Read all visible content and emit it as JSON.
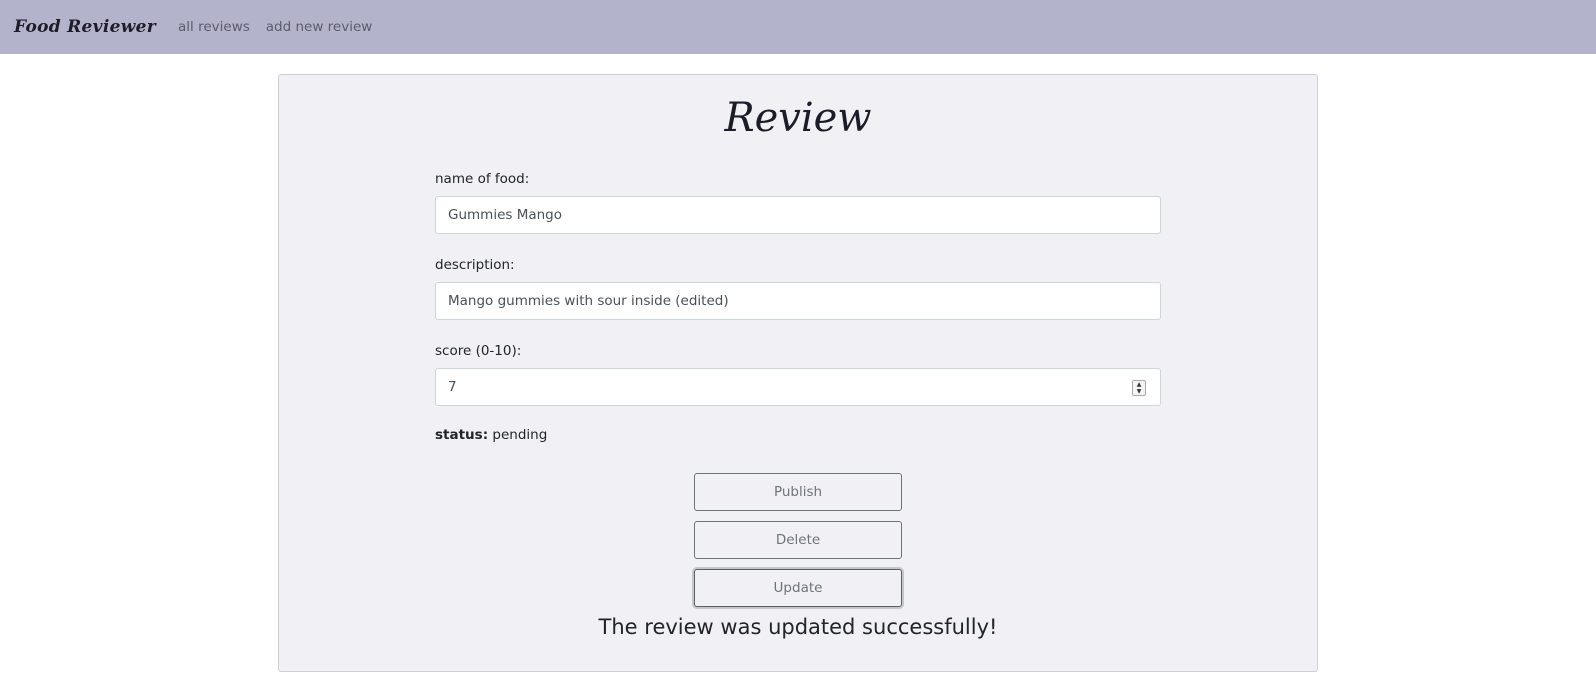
{
  "navbar": {
    "brand": "Food Reviewer",
    "links": [
      "all reviews",
      "add new review"
    ]
  },
  "review": {
    "title": "Review",
    "fields": {
      "name_label": "name of food:",
      "name_value": "Gummies Mango",
      "description_label": "description:",
      "description_value": "Mango gummies with sour inside (edited)",
      "score_label": "score (0-10):",
      "score_value": "7"
    },
    "status_key": "status:",
    "status_value": "pending",
    "buttons": {
      "publish": "Publish",
      "delete": "Delete",
      "update": "Update"
    },
    "message": "The review was updated successfully!"
  },
  "colors": {
    "navbar_bg": "#b3b3cc",
    "card_bg": "#f0f0f5",
    "button_border": "#6c757d"
  }
}
